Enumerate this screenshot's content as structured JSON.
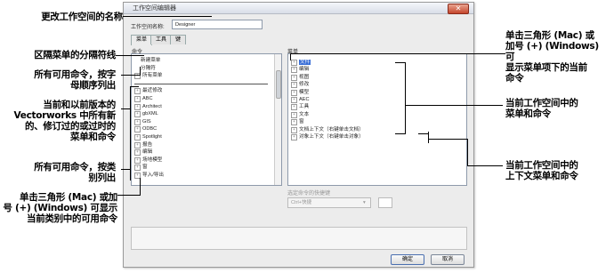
{
  "annotations": {
    "workspace_name": "更改工作空间的名称",
    "separator": "区隔菜单的分隔符线",
    "alpha_1": "所有可用命令，按字",
    "alpha_2": "母顺序列出",
    "legacy_1": "当前和以前版本的",
    "legacy_2": "Vectorworks 中所有新",
    "legacy_3": "的、修订过的或过时的",
    "legacy_4": "菜单和命令",
    "category_1": "所有可用命令，按类",
    "category_2": "别列出",
    "triangle_left_1": "单击三角形 (Mac) 或加",
    "triangle_left_2": "号 (+) (Windows) 可显示",
    "triangle_left_3": "当前类别中的可用命令",
    "triangle_right_1": "单击三角形 (Mac) 或",
    "triangle_right_2": "加号 (+) (Windows) 可",
    "triangle_right_3": "显示菜单项下的当前",
    "triangle_right_4": "命令",
    "menus_1": "当前工作空间中的",
    "menus_2": "菜单和命令",
    "context_1": "当前工作空间中的",
    "context_2": "上下文菜单和命令"
  },
  "dialog": {
    "title": "工作空间编辑器",
    "close": "✕",
    "name_label": "工作空间名称:",
    "name_value": "Designer",
    "tabs": [
      "菜单",
      "工具",
      "键"
    ],
    "commands_label": "命令",
    "menus_label": "菜单",
    "commands": [
      {
        "text": "新建菜单",
        "tree": false
      },
      {
        "text": "分隔符",
        "tree": false
      },
      {
        "text": "所有菜单",
        "tree": true
      },
      {
        "text": "",
        "tree": false
      },
      {
        "text": "最近修改",
        "tree": true
      },
      {
        "text": "ABC",
        "tree": true
      },
      {
        "text": "Architect",
        "tree": true
      },
      {
        "text": "gbXML",
        "tree": true
      },
      {
        "text": "GIS",
        "tree": true
      },
      {
        "text": "ODBC",
        "tree": true
      },
      {
        "text": "Spotlight",
        "tree": true
      },
      {
        "text": "报告",
        "tree": true
      },
      {
        "text": "编辑",
        "tree": true
      },
      {
        "text": "场地模型",
        "tree": true
      },
      {
        "text": "窗",
        "tree": true
      },
      {
        "text": "导入/导出",
        "tree": true
      }
    ],
    "menus": [
      {
        "text": "文件",
        "selected": true
      },
      {
        "text": "编辑",
        "selected": false
      },
      {
        "text": "视图",
        "selected": false
      },
      {
        "text": "修改",
        "selected": false
      },
      {
        "text": "模型",
        "selected": false
      },
      {
        "text": "AEC",
        "selected": false
      },
      {
        "text": "工具",
        "selected": false
      },
      {
        "text": "文本",
        "selected": false
      },
      {
        "text": "窗",
        "selected": false
      },
      {
        "text": "文档上下文（右键单击文档）",
        "selected": false
      },
      {
        "text": "对象上下文（右键单击对象）",
        "selected": false
      }
    ],
    "shortcut_label": "选定命令的快捷键",
    "modifier_value": "Ctrl+快捷",
    "ok": "确定",
    "cancel": "取消"
  }
}
